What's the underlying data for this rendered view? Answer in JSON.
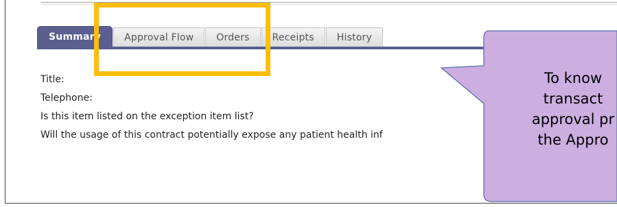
{
  "tabs": [
    {
      "label": "Summary",
      "active": true
    },
    {
      "label": "Approval Flow",
      "active": false
    },
    {
      "label": "Orders",
      "active": false
    },
    {
      "label": "Receipts",
      "active": false
    },
    {
      "label": "History",
      "active": false
    }
  ],
  "fields": {
    "title": "Title:",
    "telephone": "Telephone:",
    "exception_question": "Is this item listed on the exception item list?",
    "exposure_question": "Will the usage of this contract potentially expose any patient health inf"
  },
  "callout": {
    "line1": "To know",
    "line2": "transact",
    "line3": "approval pr",
    "line4": "the Appro"
  },
  "colors": {
    "active_tab": "#5a5f8f",
    "highlight": "#fbbd0e",
    "callout_fill": "#cdaee0",
    "callout_border": "#6b7bb0"
  }
}
